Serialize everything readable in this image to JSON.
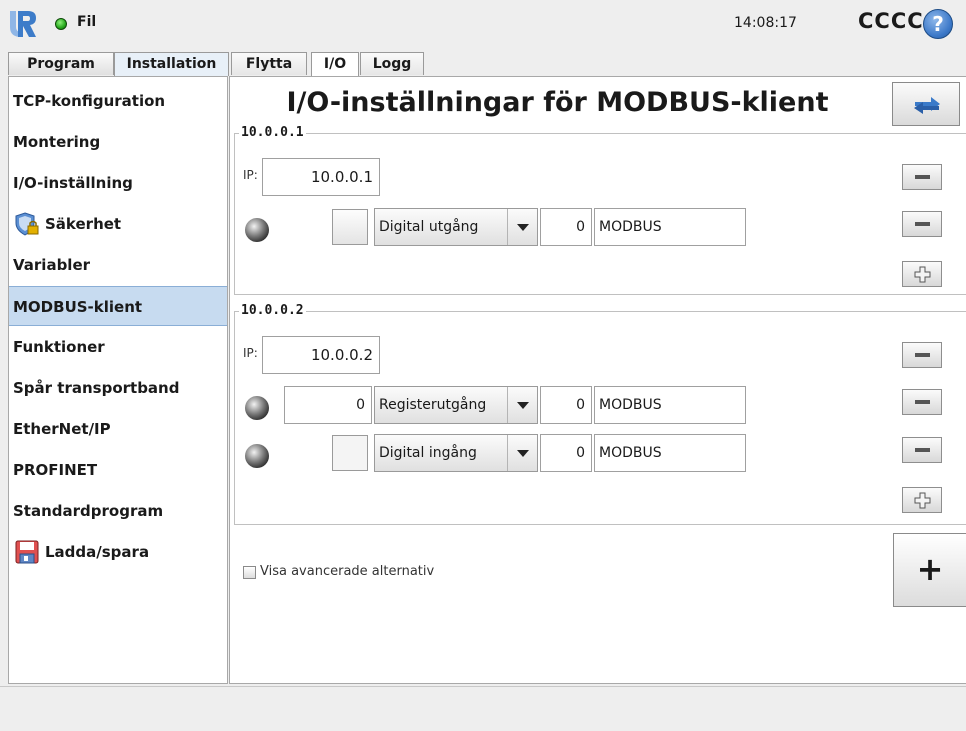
{
  "header": {
    "filename": "Fil",
    "time": "14:08:17",
    "robot_name": "CCCC",
    "help": "?"
  },
  "main_tabs": [
    "Program",
    "Installation"
  ],
  "sub_tabs": [
    "Flytta",
    "I/O",
    "Logg"
  ],
  "sidebar": {
    "items": [
      {
        "label": "TCP-konfiguration"
      },
      {
        "label": "Montering"
      },
      {
        "label": "I/O-inställning"
      },
      {
        "label": "Säkerhet",
        "icon": "shield-lock-icon"
      },
      {
        "label": "Variabler"
      },
      {
        "label": "MODBUS-klient",
        "selected": true
      },
      {
        "label": "Funktioner"
      },
      {
        "label": "Spår transportband"
      },
      {
        "label": "EtherNet/IP"
      },
      {
        "label": "PROFINET"
      },
      {
        "label": "Standardprogram"
      },
      {
        "label": "Ladda/spara",
        "icon": "save-disk-icon"
      }
    ]
  },
  "page": {
    "title": "I/O-inställningar för MODBUS-klient",
    "ip_label": "IP:",
    "advanced_label": "Visa avancerade alternativ",
    "add_symbol": "+"
  },
  "units": [
    {
      "name": "10.0.0.1",
      "ip": "10.0.0.1",
      "signals": [
        {
          "value": "",
          "type": "Digital utgång",
          "address": "0",
          "name": "MODBUS"
        }
      ]
    },
    {
      "name": "10.0.0.2",
      "ip": "10.0.0.2",
      "signals": [
        {
          "value": "0",
          "type": "Registerutgång",
          "address": "0",
          "name": "MODBUS"
        },
        {
          "value": "",
          "type": "Digital ingång",
          "address": "0",
          "name": "MODBUS"
        }
      ]
    }
  ]
}
